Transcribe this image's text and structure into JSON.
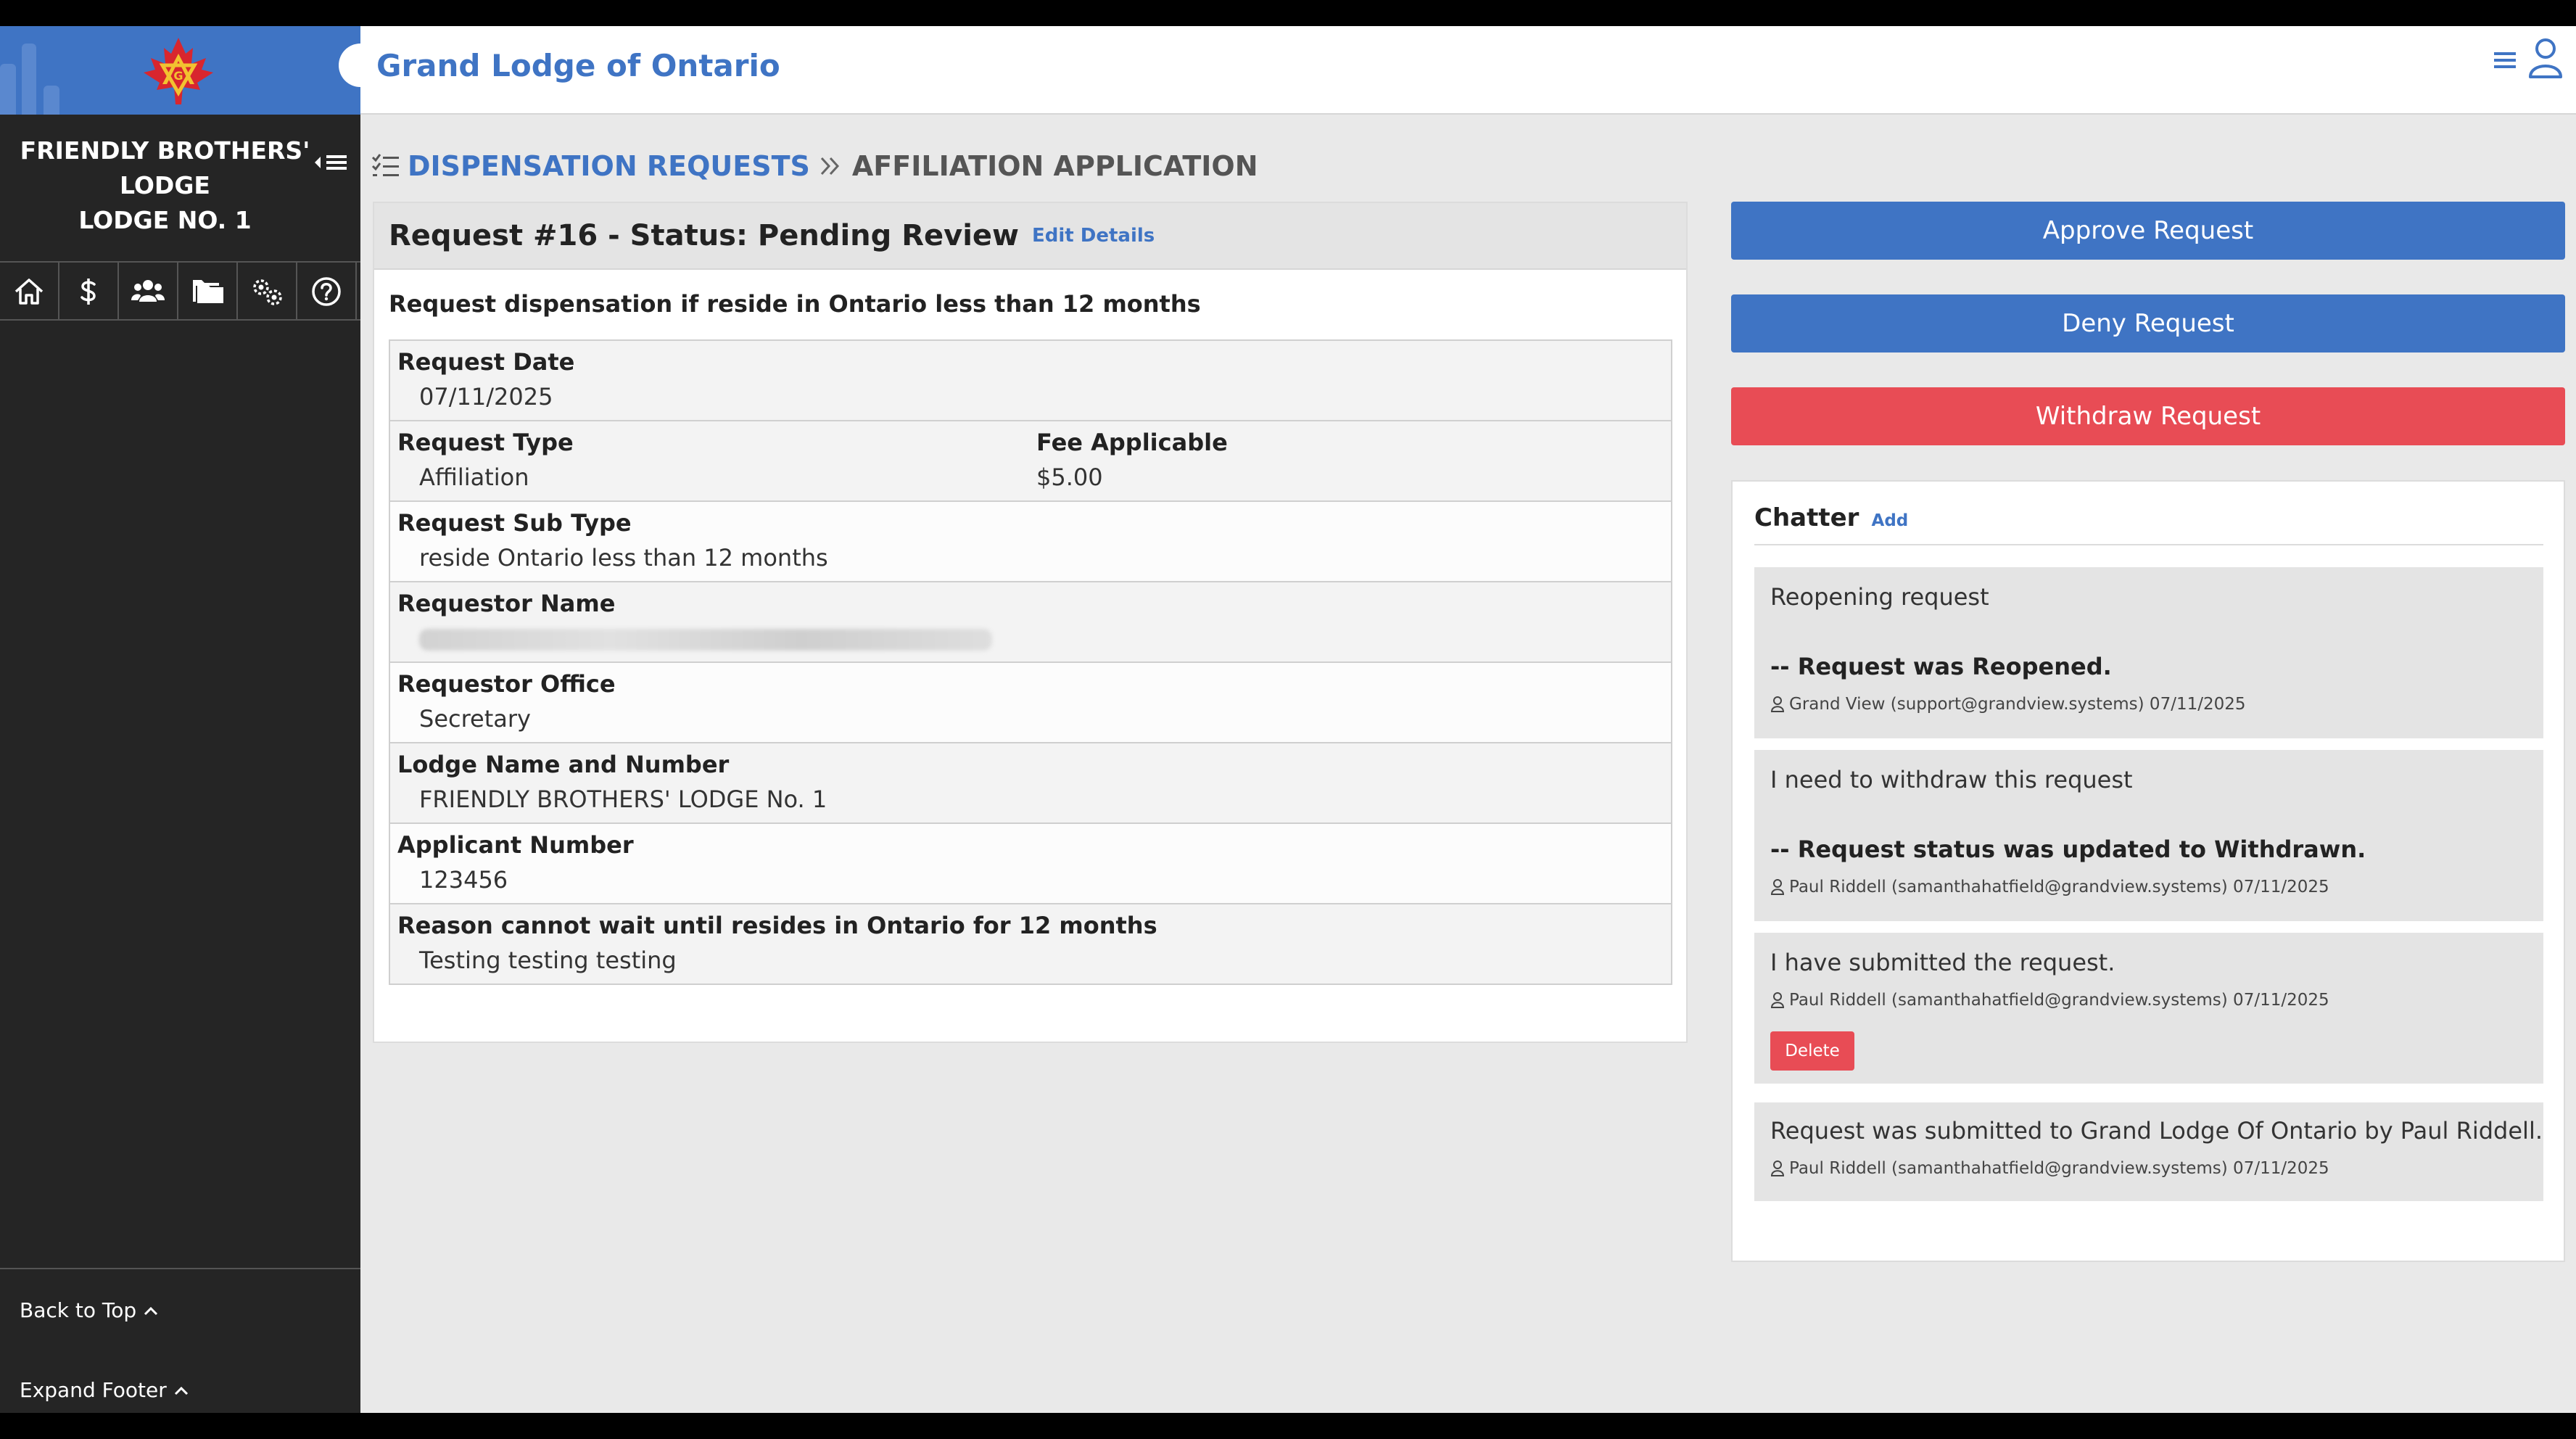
{
  "header": {
    "title": "Grand Lodge of Ontario",
    "menu_icon": "hamburger-menu-icon",
    "user_icon": "user-profile-icon"
  },
  "sidebar": {
    "lodge_name_lines": [
      "FRIENDLY BROTHERS'",
      "LODGE",
      "LODGE NO. 1"
    ],
    "nav_icons": [
      "home-icon",
      "dollar-icon",
      "members-icon",
      "folders-icon",
      "settings-icon",
      "help-icon"
    ],
    "back_to_top": "Back to Top",
    "expand_footer": "Expand Footer"
  },
  "breadcrumb": {
    "parent": "DISPENSATION REQUESTS",
    "current": "AFFILIATION APPLICATION"
  },
  "request": {
    "title": "Request #16 - Status: Pending Review",
    "edit_link": "Edit Details",
    "description": "Request dispensation if reside in Ontario less than 12 months",
    "fields": {
      "request_date": {
        "label": "Request Date",
        "value": "07/11/2025"
      },
      "request_type": {
        "label": "Request Type",
        "value": "Affiliation"
      },
      "fee_applicable": {
        "label": "Fee Applicable",
        "value": "$5.00"
      },
      "request_sub_type": {
        "label": "Request Sub Type",
        "value": "reside Ontario less than 12 months"
      },
      "requestor_name": {
        "label": "Requestor Name",
        "value": ""
      },
      "requestor_office": {
        "label": "Requestor Office",
        "value": "Secretary"
      },
      "lodge_name_number": {
        "label": "Lodge Name and Number",
        "value": "FRIENDLY BROTHERS' LODGE No. 1"
      },
      "applicant_number": {
        "label": "Applicant Number",
        "value": "123456"
      },
      "reason": {
        "label": "Reason cannot wait until resides in Ontario for 12 months",
        "value": "Testing testing testing"
      }
    }
  },
  "actions": {
    "approve": "Approve Request",
    "deny": "Deny Request",
    "withdraw": "Withdraw Request"
  },
  "chatter": {
    "title": "Chatter",
    "add_link": "Add",
    "messages": [
      {
        "text": "Reopening request",
        "status": "-- Request was Reopened.",
        "meta": "Grand View (support@grandview.systems) 07/11/2025"
      },
      {
        "text": "I need to withdraw this request",
        "status": "-- Request status was updated to Withdrawn.",
        "meta": "Paul Riddell (samanthahatfield@grandview.systems) 07/11/2025"
      },
      {
        "text": "I have submitted the request.",
        "meta": "Paul Riddell (samanthahatfield@grandview.systems) 07/11/2025",
        "delete_label": "Delete"
      },
      {
        "text": "Request was submitted to Grand Lodge Of Ontario by Paul Riddell.",
        "meta": "Paul Riddell (samanthahatfield@grandview.systems) 07/11/2025"
      }
    ]
  },
  "colors": {
    "brand_blue": "#3f74c4",
    "danger_red": "#e84c55",
    "sidebar_bg": "#252525"
  }
}
